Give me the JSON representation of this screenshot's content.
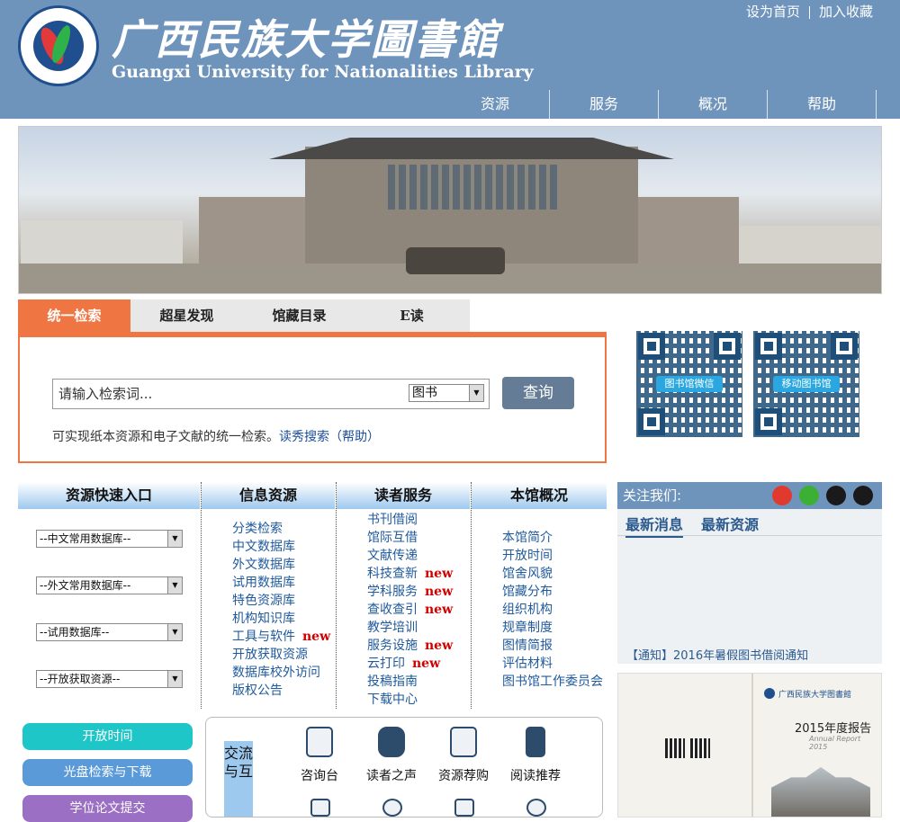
{
  "header": {
    "title_cn": "广西民族大学圖書館",
    "title_en": "Guangxi University for Nationalities Library",
    "links": [
      "设为首页",
      "加入收藏"
    ],
    "nav": [
      "资源",
      "服务",
      "概况",
      "帮助"
    ]
  },
  "search": {
    "tabs": [
      "统一检索",
      "超星发现",
      "馆藏目录",
      "E读"
    ],
    "placeholder": "请输入检索词...",
    "select_value": "图书",
    "button": "查询",
    "note": "可实现纸本资源和电子文献的统一检索。",
    "note_link": "读秀搜索",
    "note_help": "（帮助）"
  },
  "qr": {
    "left_label": "图书馆微信",
    "right_label": "移动图书馆"
  },
  "quick": {
    "headers": [
      "资源快速入口",
      "信息资源",
      "读者服务",
      "本馆概况"
    ],
    "selects": [
      "--中文常用数据库--",
      "--外文常用数据库--",
      "--试用数据库--",
      "--开放获取资源--"
    ],
    "info_resources": [
      {
        "label": "分类检索",
        "new": ""
      },
      {
        "label": "中文数据库",
        "new": ""
      },
      {
        "label": "外文数据库",
        "new": ""
      },
      {
        "label": "试用数据库",
        "new": ""
      },
      {
        "label": "特色资源库",
        "new": ""
      },
      {
        "label": "机构知识库",
        "new": ""
      },
      {
        "label": "工具与软件",
        "new": "new"
      },
      {
        "label": "开放获取资源",
        "new": ""
      },
      {
        "label": "数据库校外访问",
        "new": ""
      },
      {
        "label": "版权公告",
        "new": ""
      }
    ],
    "reader_services": [
      {
        "label": "书刊借阅",
        "new": ""
      },
      {
        "label": "馆际互借",
        "new": ""
      },
      {
        "label": "文献传递",
        "new": ""
      },
      {
        "label": "科技查新",
        "new": "new"
      },
      {
        "label": "学科服务",
        "new": "new"
      },
      {
        "label": "查收查引",
        "new": "new"
      },
      {
        "label": "教学培训",
        "new": ""
      },
      {
        "label": "服务设施",
        "new": "new"
      },
      {
        "label": "云打印",
        "new": "new"
      },
      {
        "label": "投稿指南",
        "new": ""
      },
      {
        "label": "下载中心",
        "new": ""
      }
    ],
    "overview": [
      "本馆简介",
      "开放时间",
      "馆舍风貌",
      "馆藏分布",
      "组织机构",
      "规章制度",
      "图情简报",
      "评估材料",
      "图书馆工作委员会"
    ]
  },
  "follow": {
    "label": "关注我们:",
    "news_tabs": [
      "最新消息",
      "最新资源"
    ],
    "news_line": "【通知】2016年暑假图书借阅通知"
  },
  "report": {
    "library_name": "广西民族大学图書館",
    "title": "2015年度报告",
    "subtitle": "Annual Report 2015"
  },
  "side_buttons": [
    "开放时间",
    "光盘检索与下载",
    "学位论文提交"
  ],
  "interact": {
    "label": "交流与互",
    "items": [
      "咨询台",
      "读者之声",
      "资源荐购",
      "阅读推荐"
    ]
  },
  "colors": {
    "header": "#6f94bc",
    "accent": "#ef7642",
    "new": "#d10000",
    "link": "#1f5a9c"
  }
}
